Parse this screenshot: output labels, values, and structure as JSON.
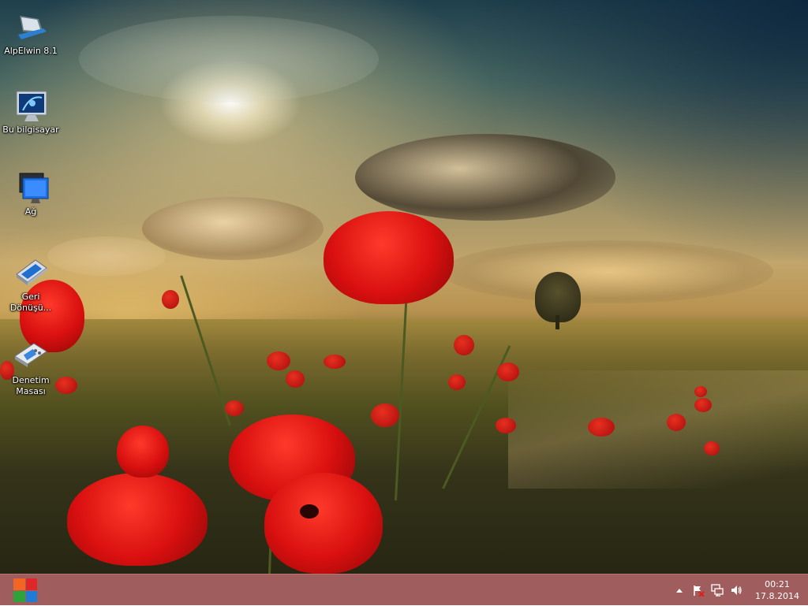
{
  "desktop": {
    "icons": [
      {
        "label": "AlpElwin 8.1",
        "icon": "user-folder-icon"
      },
      {
        "label": "Bu bilgisayar",
        "icon": "computer-icon"
      },
      {
        "label": "Ağ",
        "icon": "network-icon"
      },
      {
        "label": "Geri Dönüşü...",
        "icon": "recycle-bin-icon"
      },
      {
        "label": "Denetim Masası",
        "icon": "control-panel-icon"
      }
    ]
  },
  "taskbar": {
    "start_icon": "windows-logo-icon",
    "start_colors": [
      "#f26522",
      "#e02727",
      "#2fa33a",
      "#1e7cd6"
    ],
    "tray": {
      "icons": [
        "show-hidden-icons-chevron",
        "action-center-flag-icon",
        "network-icon",
        "volume-icon"
      ],
      "time": "00:21",
      "date": "17.8.2014"
    }
  },
  "colors": {
    "taskbar": "#a05d5e"
  }
}
